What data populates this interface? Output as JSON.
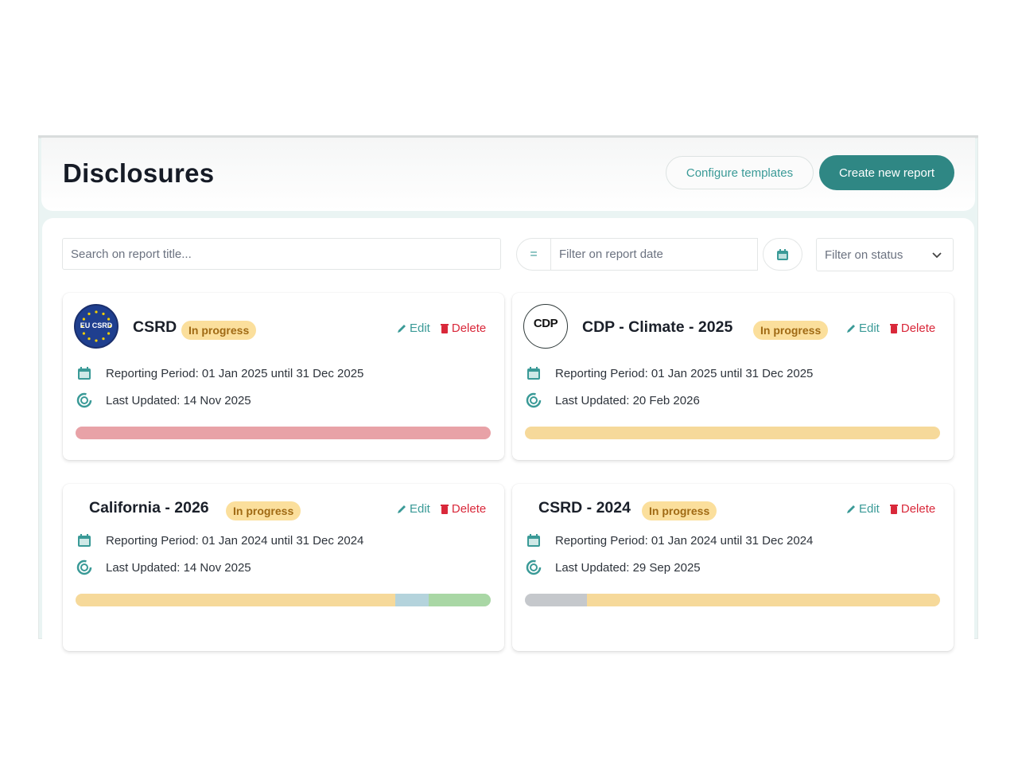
{
  "header": {
    "title": "Disclosures",
    "configure_label": "Configure templates",
    "create_label": "Create new report"
  },
  "filters": {
    "search_placeholder": "Search on report title...",
    "operator_symbol": "=",
    "date_placeholder": "Filter on report date",
    "status_placeholder": "Filter on status"
  },
  "labels": {
    "edit": "Edit",
    "delete": "Delete"
  },
  "colors": {
    "accent": "#2f8784",
    "badge_bg": "#fbdf9c",
    "delete": "#d9283a",
    "bar_red": "#e8a2a7",
    "bar_yellow": "#f6d99a",
    "bar_blue": "#b4d3dc",
    "bar_green": "#a9d7a5",
    "bar_gray": "#c5c8cc"
  },
  "cards": [
    {
      "title": "CSRD",
      "status": "In progress",
      "logo": "EU CSRD",
      "period": "Reporting Period: 01 Jan 2025 until 31 Dec 2025",
      "updated": "Last Updated: 14 Nov 2025",
      "progress": [
        {
          "color": "#e8a2a7",
          "fraction": 1.0
        }
      ]
    },
    {
      "title": "CDP - Climate - 2025",
      "status": "In progress",
      "logo": "CDP",
      "period": "Reporting Period: 01 Jan 2025 until 31 Dec 2025",
      "updated": "Last Updated: 20 Feb 2026",
      "progress": [
        {
          "color": "#f6d99a",
          "fraction": 1.0
        }
      ]
    },
    {
      "title": "California - 2026",
      "status": "In progress",
      "period": "Reporting Period: 01 Jan 2024 until 31 Dec 2024",
      "updated": "Last Updated: 14 Nov 2025",
      "progress": [
        {
          "color": "#f6d99a",
          "fraction": 0.77
        },
        {
          "color": "#b4d3dc",
          "fraction": 0.08
        },
        {
          "color": "#a9d7a5",
          "fraction": 0.15
        }
      ]
    },
    {
      "title": "CSRD - 2024",
      "status": "In progress",
      "period": "Reporting Period: 01 Jan 2024 until 31 Dec 2024",
      "updated": "Last Updated: 29 Sep 2025",
      "progress": [
        {
          "color": "#c5c8cc",
          "fraction": 0.15
        },
        {
          "color": "#f6d99a",
          "fraction": 0.85
        }
      ]
    }
  ]
}
